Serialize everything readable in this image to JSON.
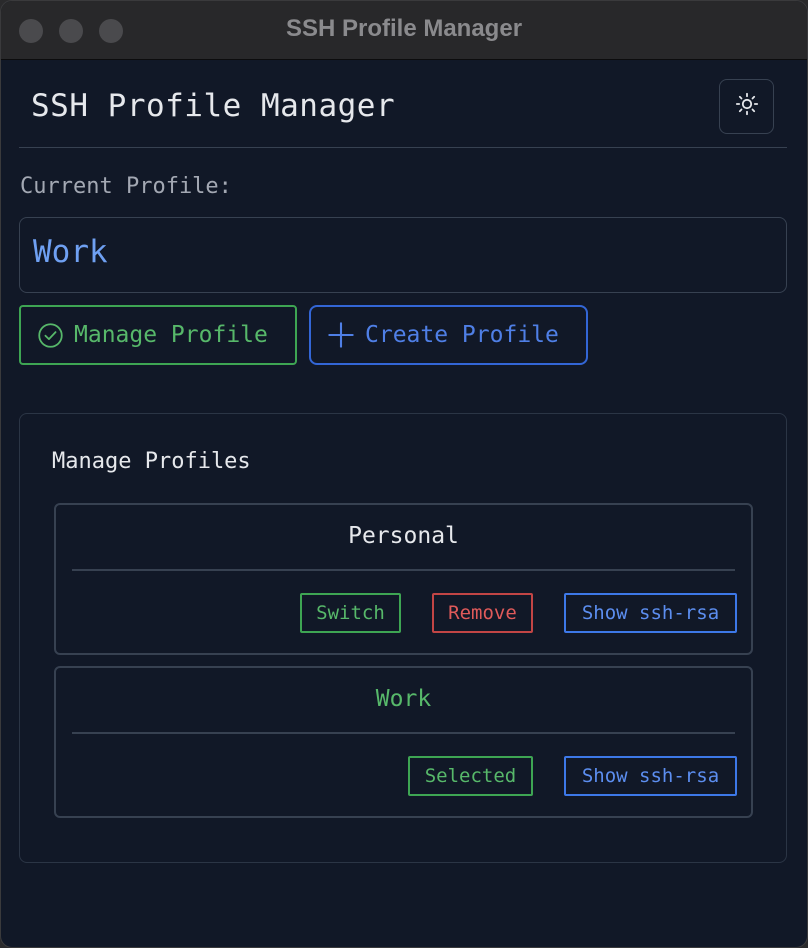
{
  "window": {
    "title": "SSH Profile Manager"
  },
  "header": {
    "title": "SSH Profile Manager",
    "theme_icon": "sun-icon"
  },
  "current": {
    "label": "Current Profile:",
    "value": "Work"
  },
  "actions": {
    "manage_label": "Manage Profile",
    "manage_icon": "check-circle-icon",
    "create_label": "Create Profile",
    "create_icon": "plus-icon"
  },
  "manage": {
    "title": "Manage Profiles",
    "profiles": [
      {
        "name": "Personal",
        "switch_label": "Switch",
        "remove_label": "Remove",
        "show_label": "Show ssh-rsa"
      },
      {
        "name": "Work",
        "selected_label": "Selected",
        "show_label": "Show ssh-rsa"
      }
    ]
  },
  "colors": {
    "background": "#111827",
    "accent_green": "#57b86a",
    "accent_blue": "#4f7fe6",
    "accent_red": "#e05a5a",
    "current_value": "#6fa0f2"
  }
}
